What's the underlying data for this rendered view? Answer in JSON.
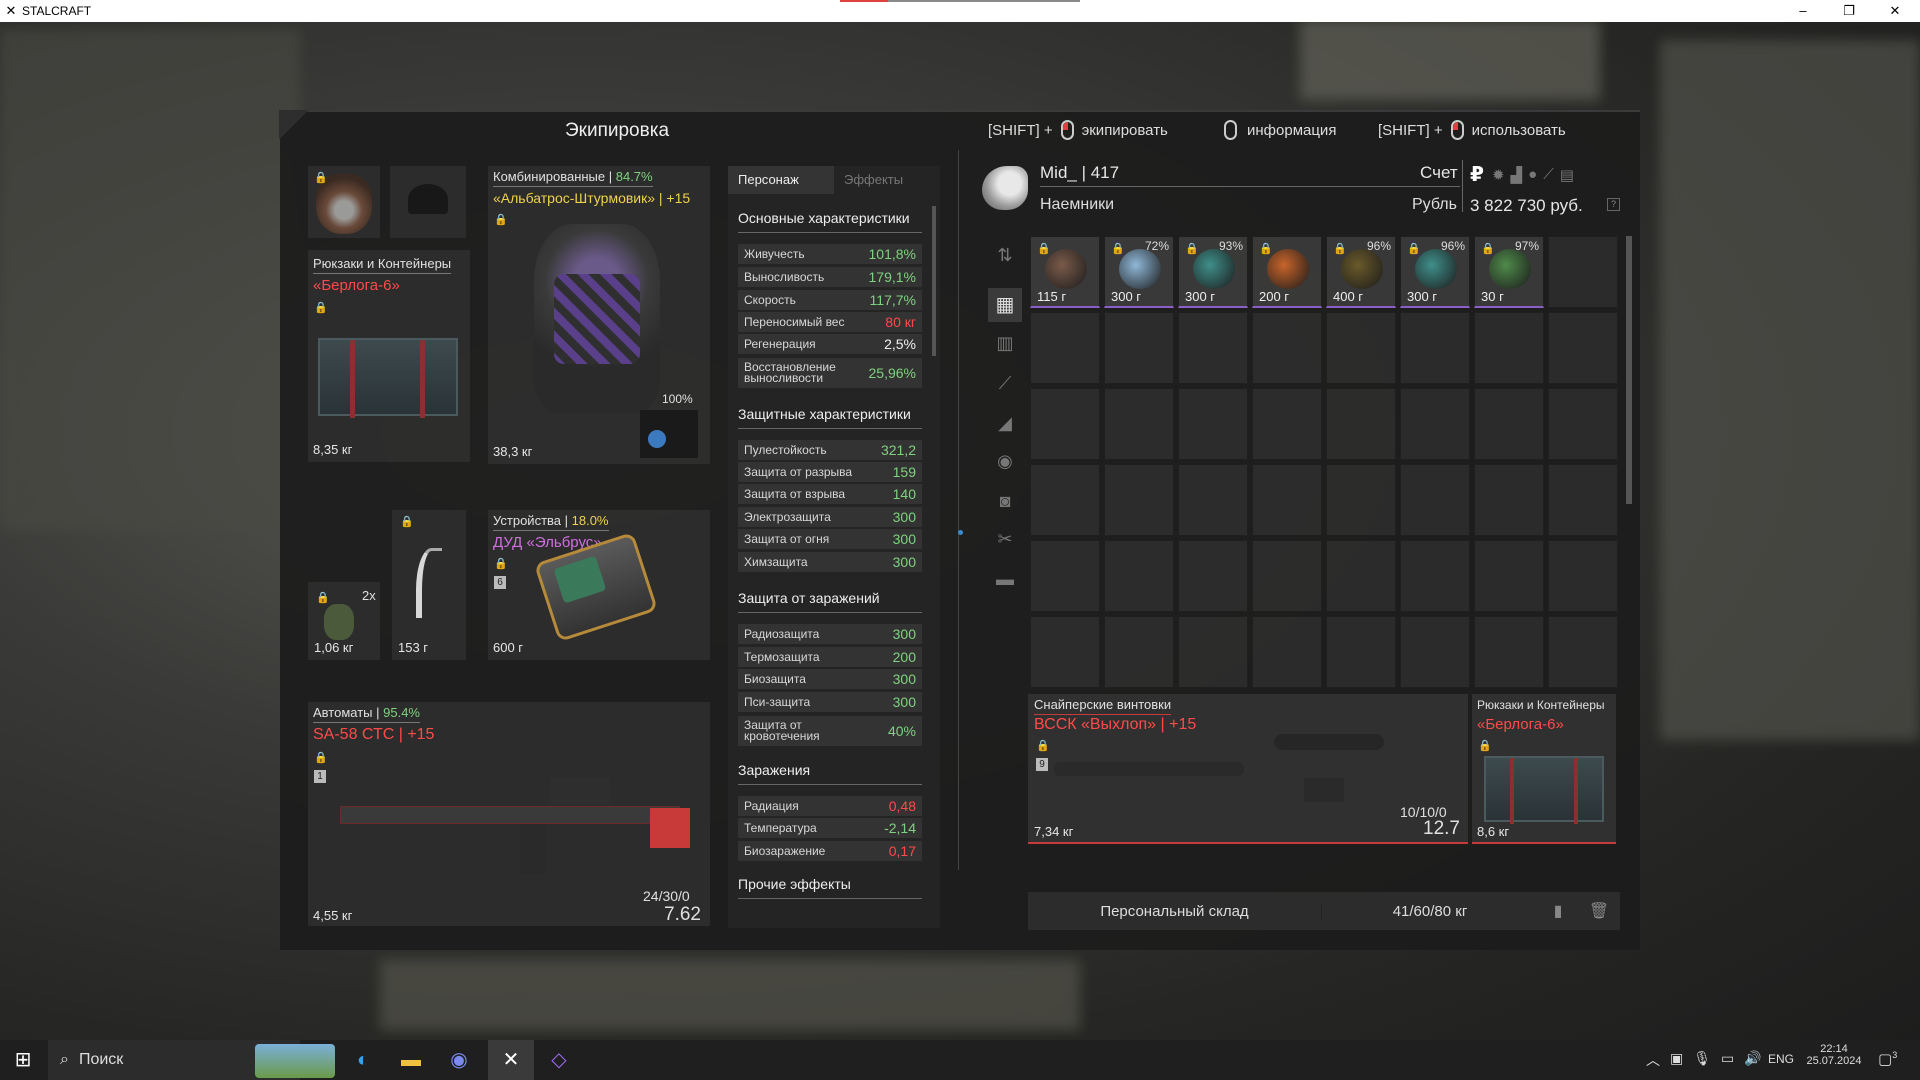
{
  "window": {
    "title": "STALCRAFT",
    "min": "–",
    "max": "❐",
    "close": "✕"
  },
  "header": {
    "title": "Экипировка",
    "hint1_key": "[SHIFT] +",
    "hint1_action": "экипировать",
    "hint2_action": "информация",
    "hint3_key": "[SHIFT] +",
    "hint3_action": "использовать"
  },
  "equip": {
    "backpack": {
      "category": "Рюкзаки и Контейнеры",
      "name": "«Берлога-6»",
      "weight": "8,35 кг"
    },
    "armor": {
      "category": "Комбинированные",
      "pct": "84.7%",
      "name": "«Альбатрос-Штурмовик» | +15",
      "weight": "38,3 кг",
      "durability": "100%"
    },
    "grenade": {
      "count": "2x",
      "weight": "1,06 кг"
    },
    "knife": {
      "weight": "153 г"
    },
    "device": {
      "category": "Устройства",
      "pct": "18.0%",
      "name": "ДУД «Эльбрус»",
      "slot": "6",
      "weight": "600 г"
    },
    "weapon": {
      "category": "Автоматы",
      "pct": "95.4%",
      "name": "SA-58 СТС | +15",
      "slot": "1",
      "weight": "4,55 кг",
      "ammo": "24/30/0",
      "caliber": "7.62"
    }
  },
  "stats": {
    "tab_char": "Персонаж",
    "tab_effects": "Эффекты",
    "main_title": "Основные характеристики",
    "main": [
      [
        "Живучесть",
        "101,8%"
      ],
      [
        "Выносливость",
        "179,1%"
      ],
      [
        "Скорость",
        "117,7%"
      ],
      [
        "Переносимый вес",
        "80 кг"
      ],
      [
        "Регенерация",
        "2,5%"
      ]
    ],
    "stamina_regen": {
      "label_a": "Восстановление",
      "label_b": "выносливости",
      "value": "25,96%"
    },
    "prot_title": "Защитные характеристики",
    "prot": [
      [
        "Пулестойкость",
        "321,2"
      ],
      [
        "Защита от разрыва",
        "159"
      ],
      [
        "Защита от взрыва",
        "140"
      ],
      [
        "Электрозащита",
        "300"
      ],
      [
        "Защита от огня",
        "300"
      ],
      [
        "Химзащита",
        "300"
      ]
    ],
    "inf_title": "Защита от заражений",
    "inf": [
      [
        "Радиозащита",
        "300"
      ],
      [
        "Термозащита",
        "200"
      ],
      [
        "Биозащита",
        "300"
      ],
      [
        "Пси-защита",
        "300"
      ]
    ],
    "bleed": {
      "label_a": "Защита от",
      "label_b": "кровотечения",
      "value": "40%"
    },
    "cont_title": "Заражения",
    "cont": [
      [
        "Радиация",
        "0,48"
      ],
      [
        "Температура",
        "-2,14"
      ],
      [
        "Биозаражение",
        "0,17"
      ]
    ],
    "other_title": "Прочие эффекты"
  },
  "player": {
    "name": "Mid_ | 417",
    "faction": "Наемники",
    "account_label": "Счет",
    "currency_label": "Рубль",
    "balance": "3 822 730 руб.",
    "ruble_sign": "₽"
  },
  "inventory": {
    "items": [
      {
        "pct": "",
        "weight": "115 г",
        "color": "#7a5a4a"
      },
      {
        "pct": "72%",
        "weight": "300 г",
        "color": "#8fb8d8"
      },
      {
        "pct": "93%",
        "weight": "300 г",
        "color": "#3f8f8a"
      },
      {
        "pct": "",
        "weight": "200 г",
        "color": "#c8642a"
      },
      {
        "pct": "96%",
        "weight": "400 г",
        "color": "#6a5a2a"
      },
      {
        "pct": "96%",
        "weight": "300 г",
        "color": "#3f8f8a"
      },
      {
        "pct": "97%",
        "weight": "30 г",
        "color": "#4f8a4a"
      }
    ],
    "sniper": {
      "category": "Снайперские винтовки",
      "name": "ВССК «Выхлоп» | +15",
      "slot": "9",
      "weight": "7,34 кг",
      "ammo": "10/10/0",
      "caliber": "12.7"
    },
    "backpack2": {
      "category": "Рюкзаки и Контейнеры",
      "name": "«Берлога-6»",
      "weight": "8,6 кг"
    },
    "storage_label": "Персональный склад",
    "capacity": "41/60/80 кг"
  },
  "taskbar": {
    "search": "Поиск",
    "lang": "ENG",
    "time": "22:14",
    "date": "25.07.2024",
    "notif": "3"
  }
}
